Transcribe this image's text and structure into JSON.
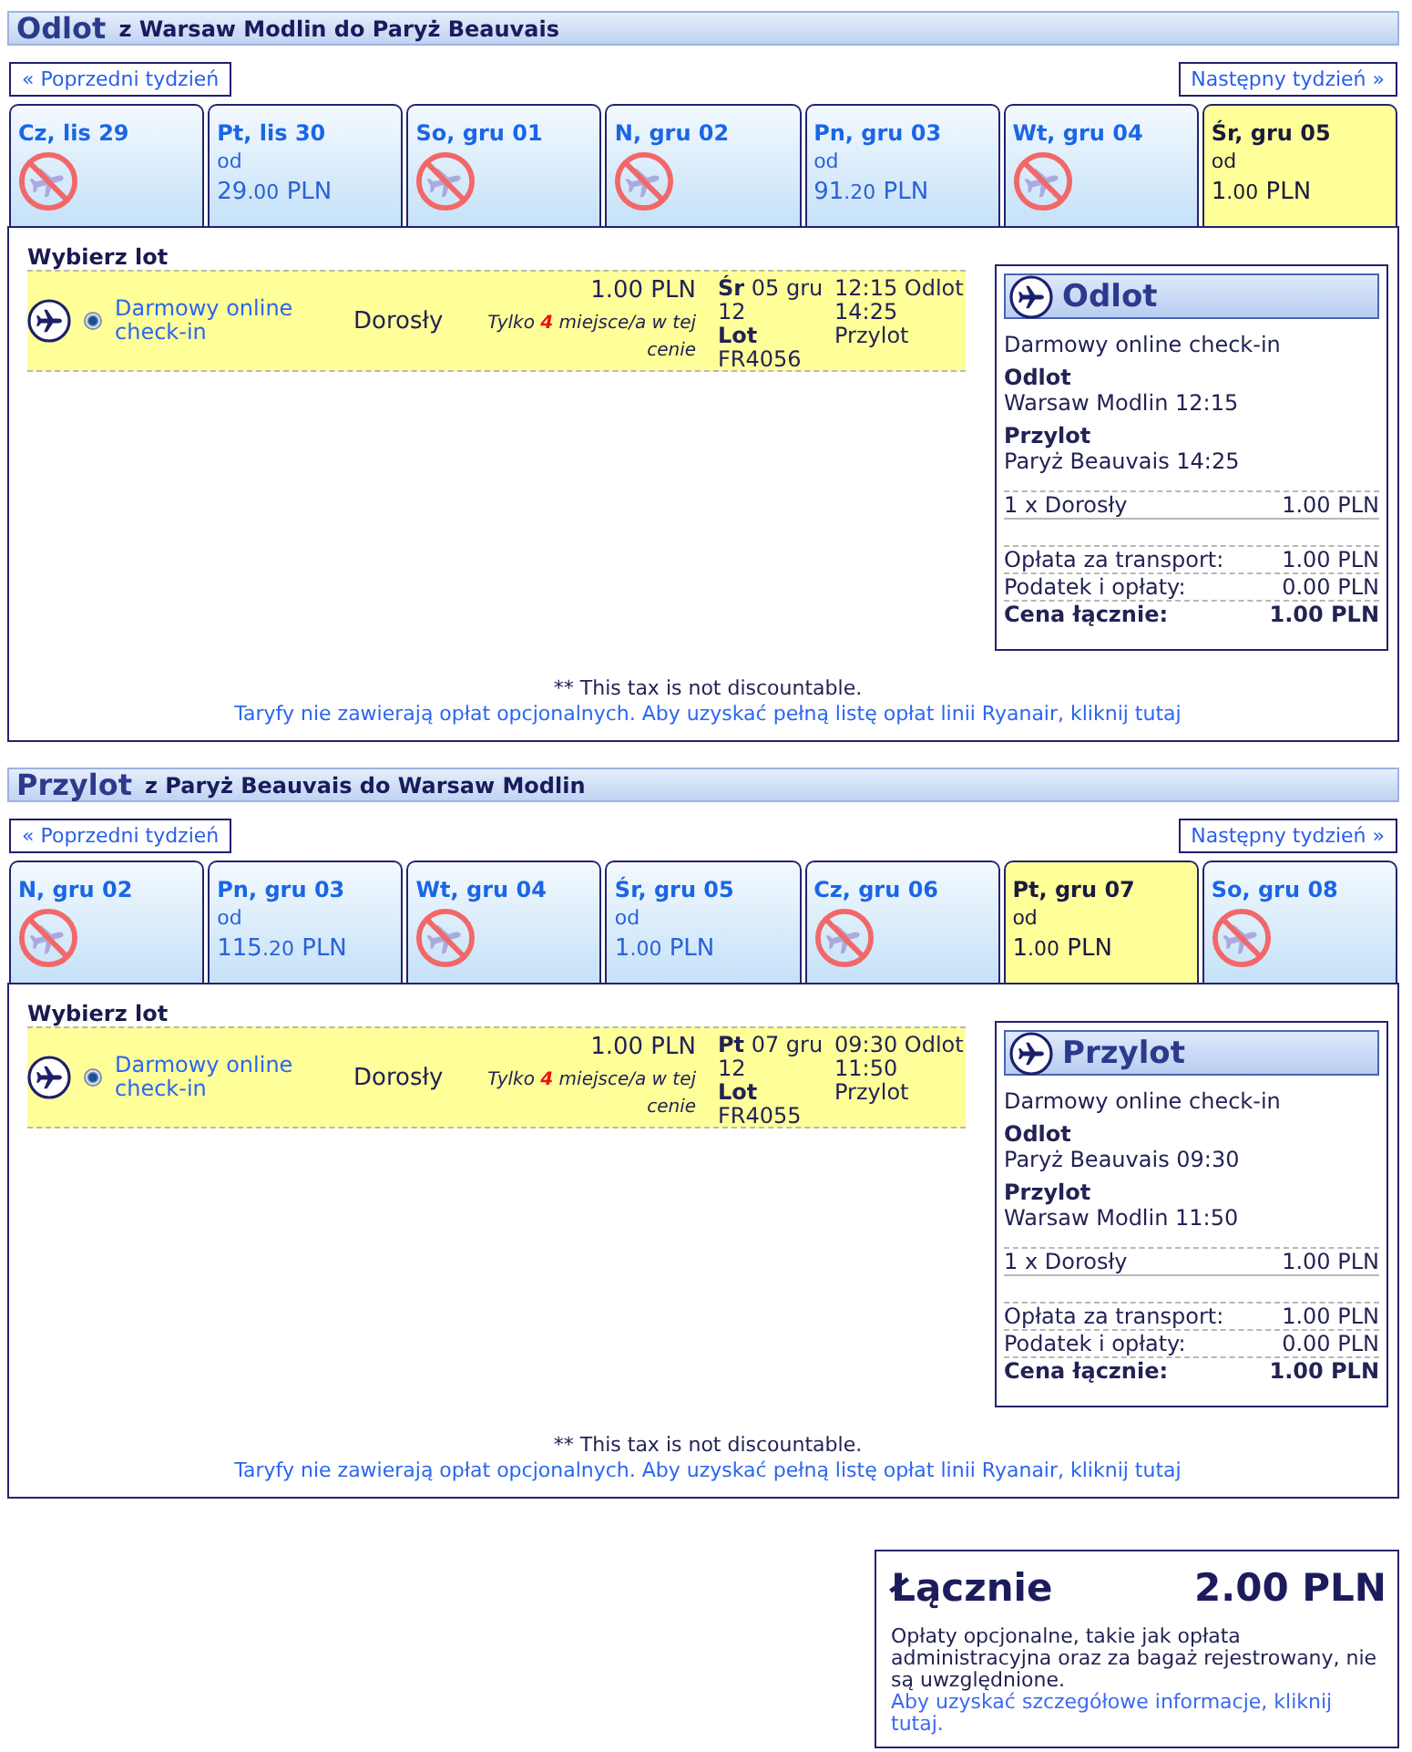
{
  "sections": [
    {
      "title": "Odlot",
      "route": "z Warsaw Modlin do Paryż Beauvais",
      "prev_week": "« Poprzedni tydzień",
      "next_week": "Następny tydzień »",
      "days": [
        {
          "label": "Cz, lis 29",
          "kind": "no_flights",
          "selected": false
        },
        {
          "label": "Pt, lis 30",
          "kind": "fare",
          "selected": false,
          "from": "od",
          "price": "29",
          "cents": ".00",
          "currency": "PLN"
        },
        {
          "label": "So, gru 01",
          "kind": "no_flights",
          "selected": false
        },
        {
          "label": "N, gru 02",
          "kind": "no_flights",
          "selected": false
        },
        {
          "label": "Pn, gru 03",
          "kind": "fare",
          "selected": false,
          "from": "od",
          "price": "91",
          "cents": ".20",
          "currency": "PLN"
        },
        {
          "label": "Wt, gru 04",
          "kind": "no_flights",
          "selected": false
        },
        {
          "label": "Śr, gru 05",
          "kind": "fare",
          "selected": true,
          "from": "od",
          "price": "1",
          "cents": ".00",
          "currency": "PLN"
        }
      ],
      "heading": "Wybierz lot",
      "flights": [
        {
          "selected": true,
          "fare": "Darmowy online check-in",
          "passenger": "Dorosły",
          "price": "1.00 PLN",
          "seats": "Tylko **4** miejsce/a w tej cenie",
          "date": "**Śr** 05 gru 12",
          "flight_label": "Lot",
          "flight_number": "FR4056",
          "departure": "12:15 Odlot",
          "arrival": "14:25 Przylot"
        }
      ],
      "summary": {
        "title": "Odlot",
        "fare": "Darmowy online check-in",
        "legs": [
          {
            "label": "Odlot",
            "value": "Warsaw Modlin 12:15"
          },
          {
            "label": "Przylot",
            "value": "Paryż Beauvais 14:25"
          }
        ],
        "passengers": [
          {
            "label": "1 x Dorosły",
            "amount": "1.00 PLN"
          }
        ],
        "charges": [
          {
            "label": "Opłata za transport:",
            "amount": "1.00 PLN"
          },
          {
            "label": "Podatek i opłaty:",
            "amount": "0.00 PLN"
          }
        ],
        "total": {
          "label": "Cena łącznie:",
          "amount": "1.00 PLN"
        }
      },
      "tax_note": "** This tax is not discountable.",
      "fees_link": "Taryfy nie zawierają opłat opcjonalnych. Aby uzyskać pełną listę opłat linii Ryanair, kliknij tutaj"
    },
    {
      "title": "Przylot",
      "route": "z Paryż Beauvais do Warsaw Modlin",
      "prev_week": "« Poprzedni tydzień",
      "next_week": "Następny tydzień »",
      "days": [
        {
          "label": "N, gru 02",
          "kind": "no_flights",
          "selected": false
        },
        {
          "label": "Pn, gru 03",
          "kind": "fare",
          "selected": false,
          "from": "od",
          "price": "115",
          "cents": ".20",
          "currency": "PLN"
        },
        {
          "label": "Wt, gru 04",
          "kind": "no_flights",
          "selected": false
        },
        {
          "label": "Śr, gru 05",
          "kind": "fare",
          "selected": false,
          "from": "od",
          "price": "1",
          "cents": ".00",
          "currency": "PLN"
        },
        {
          "label": "Cz, gru 06",
          "kind": "no_flights",
          "selected": false
        },
        {
          "label": "Pt, gru 07",
          "kind": "fare",
          "selected": true,
          "from": "od",
          "price": "1",
          "cents": ".00",
          "currency": "PLN"
        },
        {
          "label": "So, gru 08",
          "kind": "no_flights",
          "selected": false
        }
      ],
      "heading": "Wybierz lot",
      "flights": [
        {
          "selected": true,
          "fare": "Darmowy online check-in",
          "passenger": "Dorosły",
          "price": "1.00 PLN",
          "seats": "Tylko **4** miejsce/a w tej cenie",
          "date": "**Pt** 07 gru 12",
          "flight_label": "Lot",
          "flight_number": "FR4055",
          "departure": "09:30 Odlot",
          "arrival": "11:50 Przylot"
        }
      ],
      "summary": {
        "title": "Przylot",
        "fare": "Darmowy online check-in",
        "legs": [
          {
            "label": "Odlot",
            "value": "Paryż Beauvais 09:30"
          },
          {
            "label": "Przylot",
            "value": "Warsaw Modlin 11:50"
          }
        ],
        "passengers": [
          {
            "label": "1 x Dorosły",
            "amount": "1.00 PLN"
          }
        ],
        "charges": [
          {
            "label": "Opłata za transport:",
            "amount": "1.00 PLN"
          },
          {
            "label": "Podatek i opłaty:",
            "amount": "0.00 PLN"
          }
        ],
        "total": {
          "label": "Cena łącznie:",
          "amount": "1.00 PLN"
        }
      },
      "tax_note": "** This tax is not discountable.",
      "fees_link": "Taryfy nie zawierają opłat opcjonalnych. Aby uzyskać pełną listę opłat linii Ryanair, kliknij tutaj"
    }
  ],
  "grand_total": {
    "label": "Łącznie",
    "amount": "2.00 PLN",
    "note": "Opłaty opcjonalne, takie jak opłata administracyjna oraz za bagaż rejestrowany, nie są uwzględnione.",
    "link": "Aby uzyskać szczegółowe informacje, kliknij tutaj."
  }
}
